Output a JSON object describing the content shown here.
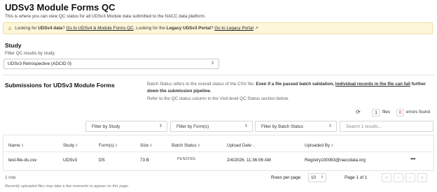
{
  "page": {
    "title": "UDSv3 Module Forms QC",
    "subtitle": "This is where you can view QC status for all UDSv3 Module data submitted to the NACC data platform."
  },
  "banner": {
    "prefix": "Looking for",
    "udsv4_bold": "UDSv4 data",
    "q1": "?",
    "udsv4_link": "Go to UDSv4 & Module Forms QC",
    "mid": ". Looking for the",
    "legacy_bold": "Legacy UDSv3 Portal",
    "q2": "?",
    "legacy_link": "Go to Legacy Portal"
  },
  "study": {
    "heading": "Study",
    "description": "Filter QC results by study.",
    "selected": "UDSv3 Retrospective (ADCID 0)"
  },
  "submissions": {
    "heading": "Submissions for UDSv3 Module Forms",
    "note_1": "Batch Status refers to the overall status of the CSV file.",
    "note_2": "Even if a file passed batch validation,",
    "note_3": "individual records in the file can fail",
    "note_4": "further down the submission pipeline.",
    "note_5": "Refer to the QC status column in the Visit-level QC Status section below."
  },
  "counts": {
    "files_count": "1",
    "files_label": "files",
    "errors_count": "0",
    "errors_label": "errors found"
  },
  "filters": {
    "study": "Filter by Study",
    "forms": "Filter by Form(s)",
    "batch_status": "Filter by Batch Status",
    "search_placeholder": "Search 1 results..."
  },
  "table": {
    "headers": [
      "Name",
      "Study",
      "Form(s)",
      "Size",
      "Batch Status",
      "Upload Date",
      "Uploaded By"
    ],
    "rows": [
      {
        "name": "test-file-ds.csv",
        "study": "UDSv3",
        "forms": "DS",
        "size": "73 B",
        "batch_status": "PENDING",
        "upload_date": "2/4/2026, 11:36:06 AM",
        "uploaded_by": "Registry100083@naccdata.org"
      }
    ]
  },
  "footer": {
    "row_count": "1 row",
    "note": "Recently uploaded files may take a few moments to appear on this page.",
    "rows_per_page_label": "Rows per page",
    "rows_per_page_value": "10",
    "page_of": "Page 1 of 1"
  },
  "colors": {
    "banner_bg": "#fdf6d9",
    "error_count": "#d93025"
  }
}
